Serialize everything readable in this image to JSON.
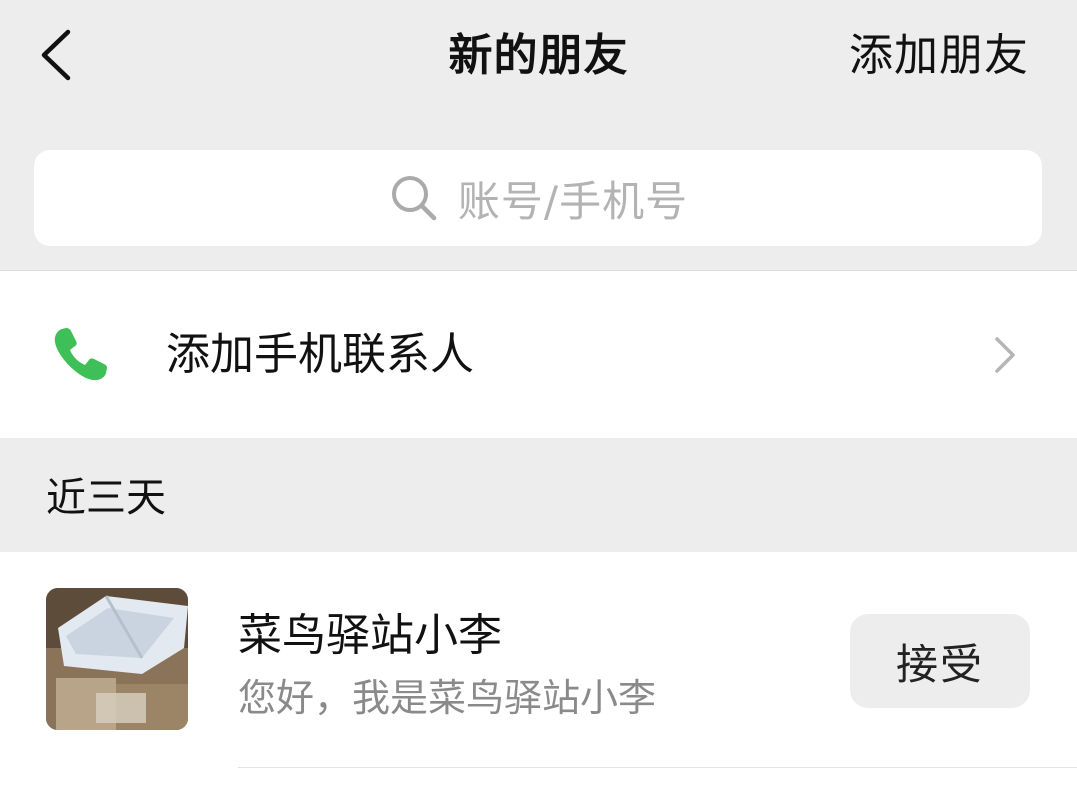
{
  "header": {
    "back_icon": "chevron-left-icon",
    "title": "新的朋友",
    "add_friend_label": "添加朋友"
  },
  "search": {
    "icon": "search-icon",
    "placeholder": "账号/手机号"
  },
  "phone_contacts": {
    "icon": "phone-icon",
    "icon_color": "#3fbf57",
    "label": "添加手机联系人",
    "chevron": "chevron-right-icon"
  },
  "section": {
    "title": "近三天"
  },
  "requests": [
    {
      "name": "菜鸟驿站小李",
      "message": "您好，我是菜鸟驿站小李",
      "avatar": "package-photo-avatar",
      "action_label": "接受"
    }
  ]
}
